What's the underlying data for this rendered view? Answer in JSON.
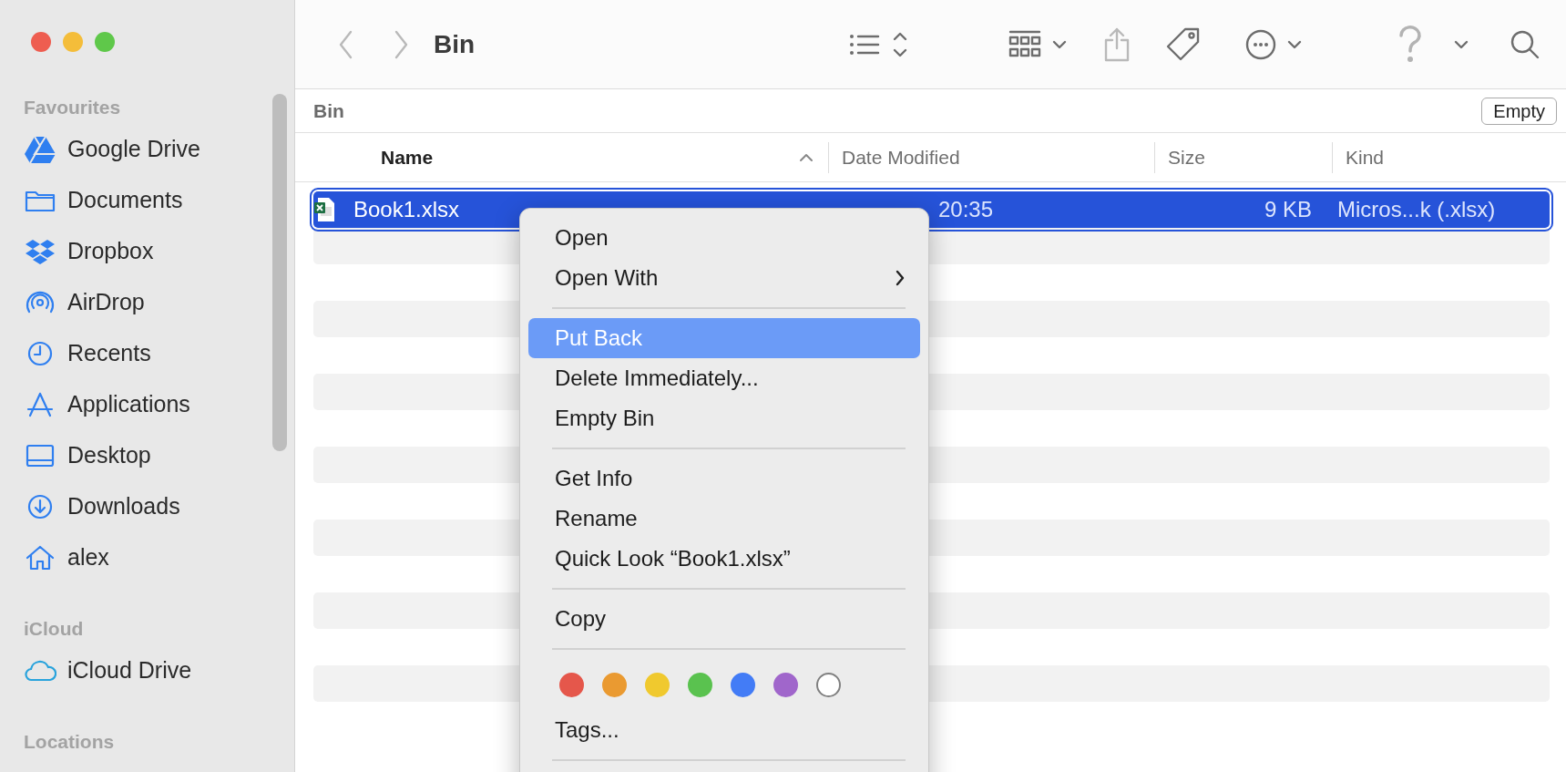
{
  "window": {
    "title": "Bin"
  },
  "sidebar": {
    "sections": [
      {
        "title": "Favourites",
        "items": [
          {
            "label": "Google Drive",
            "kind": "drive"
          },
          {
            "label": "Documents",
            "kind": "folder"
          },
          {
            "label": "Dropbox",
            "kind": "dropbox"
          },
          {
            "label": "AirDrop",
            "kind": "airdrop"
          },
          {
            "label": "Recents",
            "kind": "clock"
          },
          {
            "label": "Applications",
            "kind": "apps"
          },
          {
            "label": "Desktop",
            "kind": "desktop"
          },
          {
            "label": "Downloads",
            "kind": "download"
          },
          {
            "label": "alex",
            "kind": "home"
          }
        ]
      },
      {
        "title": "iCloud",
        "items": [
          {
            "label": "iCloud Drive",
            "kind": "cloud"
          }
        ]
      },
      {
        "title": "Locations"
      }
    ]
  },
  "path_bar": {
    "label": "Bin",
    "button": "Empty"
  },
  "table": {
    "columns": [
      {
        "label": "Name",
        "sorted": true
      },
      {
        "label": "Date Modified",
        "sorted": false
      },
      {
        "label": "Size",
        "sorted": false
      },
      {
        "label": "Kind",
        "sorted": false
      }
    ],
    "rows": [
      {
        "name": "Book1.xlsx",
        "date": "20:35",
        "size": "9 KB",
        "kind": "Micros...k (.xlsx)",
        "selected": true
      }
    ]
  },
  "context_menu": {
    "items": [
      {
        "kind": "item",
        "label": "Open",
        "submenu": false,
        "selected": false
      },
      {
        "kind": "item",
        "label": "Open With",
        "submenu": true,
        "selected": false
      },
      {
        "kind": "separator"
      },
      {
        "kind": "item",
        "label": "Put Back",
        "submenu": false,
        "selected": true
      },
      {
        "kind": "item",
        "label": "Delete Immediately...",
        "submenu": false,
        "selected": false
      },
      {
        "kind": "item",
        "label": "Empty Bin",
        "submenu": false,
        "selected": false
      },
      {
        "kind": "separator"
      },
      {
        "kind": "item",
        "label": "Get Info",
        "submenu": false,
        "selected": false
      },
      {
        "kind": "item",
        "label": "Rename",
        "submenu": false,
        "selected": false
      },
      {
        "kind": "item",
        "label": "Quick Look “Book1.xlsx”",
        "submenu": false,
        "selected": false
      },
      {
        "kind": "separator"
      },
      {
        "kind": "item",
        "label": "Copy",
        "submenu": false,
        "selected": false
      },
      {
        "kind": "separator"
      },
      {
        "kind": "tags",
        "tags": [
          {
            "color": "#e5574b"
          },
          {
            "color": "#ea9a31"
          },
          {
            "color": "#f0c92e"
          },
          {
            "color": "#5ac24f"
          },
          {
            "color": "#437cf6"
          },
          {
            "color": "#a066cb"
          },
          {
            "color": "#ffffff"
          }
        ]
      },
      {
        "kind": "item",
        "label": "Tags...",
        "submenu": false,
        "selected": false
      },
      {
        "kind": "separator"
      }
    ]
  }
}
